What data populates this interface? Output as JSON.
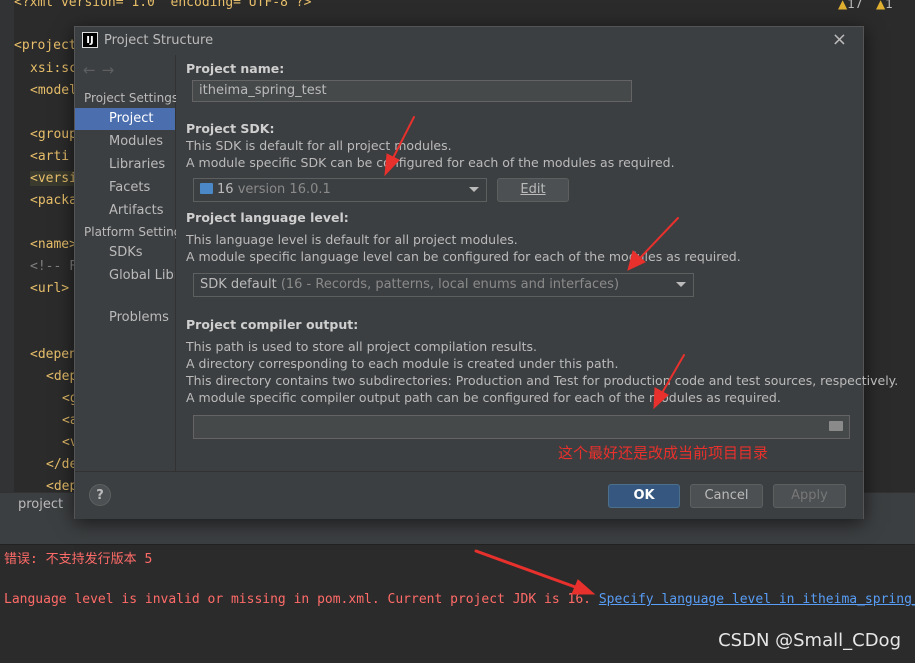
{
  "editor": {
    "xml_header": "<?xml version=\"1.0\" encoding=\"UTF-8\"?>",
    "warnings": "17",
    "weak_warnings": "1",
    "code_lines": [
      "<project",
      "xsi:sc",
      "<model",
      "",
      "<group",
      "<arti",
      "<versi",
      "<packa",
      "",
      "<name>",
      "<!-- F",
      "<url>",
      "",
      "",
      "<depen",
      "<dep",
      "<g",
      "<a",
      "<v",
      "</de",
      "<dep"
    ],
    "breadcrumb": "project"
  },
  "dialog": {
    "title": "Project Structure",
    "sidebar": {
      "group_project_settings": "Project Settings",
      "group_platform_settings": "Platform Settings",
      "items": [
        {
          "label": "Project"
        },
        {
          "label": "Modules"
        },
        {
          "label": "Libraries"
        },
        {
          "label": "Facets"
        },
        {
          "label": "Artifacts"
        },
        {
          "label": "SDKs"
        },
        {
          "label": "Global Libraries"
        },
        {
          "label": "Problems"
        }
      ]
    },
    "project_name": {
      "label": "Project name:",
      "value": "itheima_spring_test"
    },
    "project_sdk": {
      "label": "Project SDK:",
      "desc1": "This SDK is default for all project modules.",
      "desc2": "A module specific SDK can be configured for each of the modules as required.",
      "selected_version": "16",
      "selected_detail": "version 16.0.1",
      "edit_button": "Edit"
    },
    "language_level": {
      "label": "Project language level:",
      "desc1": "This language level is default for all project modules.",
      "desc2": "A module specific language level can be configured for each of the modules as required.",
      "selected": "SDK default",
      "selected_detail": "(16 - Records, patterns, local enums and interfaces)"
    },
    "compiler_output": {
      "label": "Project compiler output:",
      "desc1": "This path is used to store all project compilation results.",
      "desc2": "A directory corresponding to each module is created under this path.",
      "desc3": "This directory contains two subdirectories: Production and Test for production code and test sources, respectively.",
      "desc4": "A module specific compiler output path can be configured for each of the modules as required.",
      "value": ""
    },
    "annotation": "这个最好还是改成当前项目目录",
    "footer": {
      "help": "?",
      "ok": "OK",
      "cancel": "Cancel",
      "apply": "Apply"
    }
  },
  "console": {
    "error1": "错误: 不支持发行版本 5",
    "error2": "Language level is invalid or missing in pom.xml. Current project JDK is 16.",
    "link": "Specify language level in itheima_spring_test"
  },
  "watermark": "CSDN @Small_CDog",
  "colors": {
    "accent": "#4b6eaf",
    "primary_button": "#365880",
    "error_text": "#ff6b68",
    "link": "#589df6",
    "annotation": "#e8302c"
  }
}
